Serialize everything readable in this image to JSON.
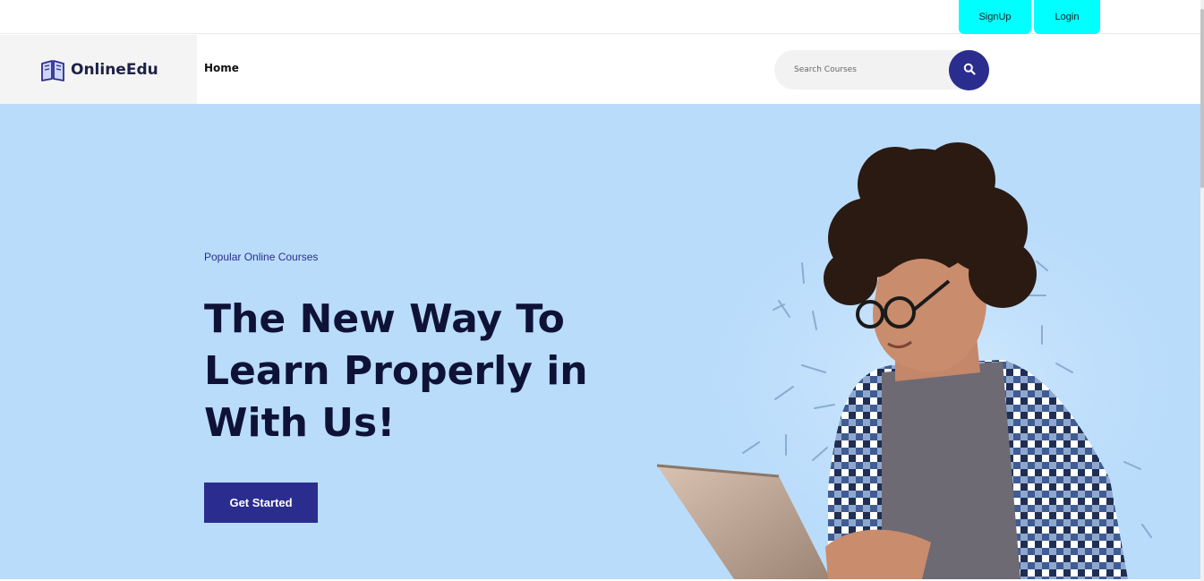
{
  "topbar": {
    "signup_label": "SignUp",
    "login_label": "Login",
    "accent": "#00ffff"
  },
  "header": {
    "logo_text": "OnlineEdu",
    "nav": {
      "home_label": "Home"
    },
    "search": {
      "placeholder": "Search Courses",
      "button_icon": "search-icon"
    }
  },
  "hero": {
    "eyebrow": "Popular Online Courses",
    "headline_line1": "The New Way To",
    "headline_line2": "Learn Properly in",
    "headline_line3": "With Us!",
    "cta_label": "Get Started",
    "image": "student-with-laptop-illustration"
  },
  "colors": {
    "brand": "#2b2d8e",
    "hero_bg": "#b9dcfb",
    "headline": "#0f1237"
  }
}
